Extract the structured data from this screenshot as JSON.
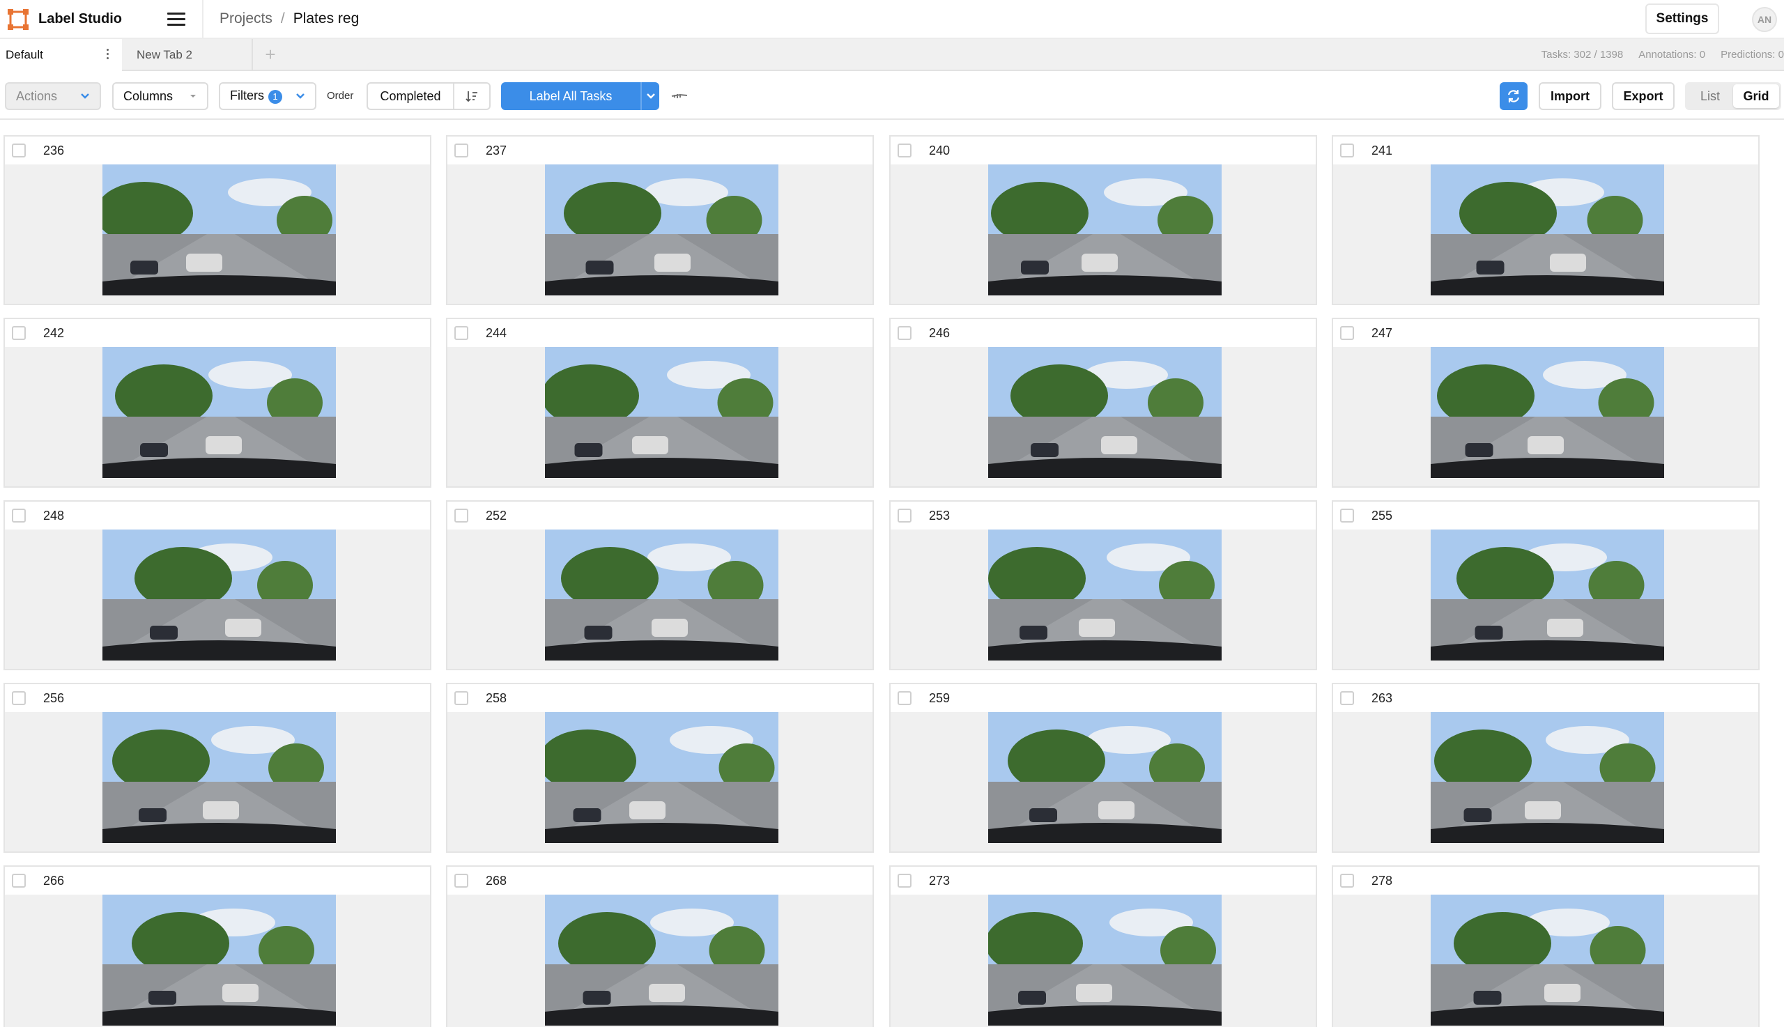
{
  "app": {
    "name": "Label Studio"
  },
  "breadcrumb": {
    "projects": "Projects",
    "separator": "/",
    "current": "Plates reg"
  },
  "header": {
    "settings_label": "Settings",
    "avatar_initials": "AN"
  },
  "tabs": [
    {
      "label": "Default"
    },
    {
      "label": "New Tab 2"
    }
  ],
  "tab_add": "+",
  "stats": {
    "tasks": "Tasks: 302 / 1398",
    "annotations": "Annotations: 0",
    "predictions": "Predictions: 0"
  },
  "toolbar": {
    "actions_label": "Actions",
    "columns_label": "Columns",
    "filters_label": "Filters",
    "filters_count": "1",
    "order_label": "Order",
    "order_value": "Completed",
    "label_all_label": "Label All Tasks",
    "import_label": "Import",
    "export_label": "Export",
    "view_list": "List",
    "view_grid": "Grid"
  },
  "colors": {
    "accent": "#3b8de8",
    "sky": "#a9c9ee",
    "road": "#8f9296",
    "tree": "#3d6b2e"
  },
  "tasks": [
    {
      "id": "236"
    },
    {
      "id": "237"
    },
    {
      "id": "240"
    },
    {
      "id": "241"
    },
    {
      "id": "242"
    },
    {
      "id": "244"
    },
    {
      "id": "246"
    },
    {
      "id": "247"
    },
    {
      "id": "248"
    },
    {
      "id": "252"
    },
    {
      "id": "253"
    },
    {
      "id": "255"
    },
    {
      "id": "256"
    },
    {
      "id": "258"
    },
    {
      "id": "259"
    },
    {
      "id": "263"
    },
    {
      "id": "266"
    },
    {
      "id": "268"
    },
    {
      "id": "273"
    },
    {
      "id": "278"
    }
  ]
}
